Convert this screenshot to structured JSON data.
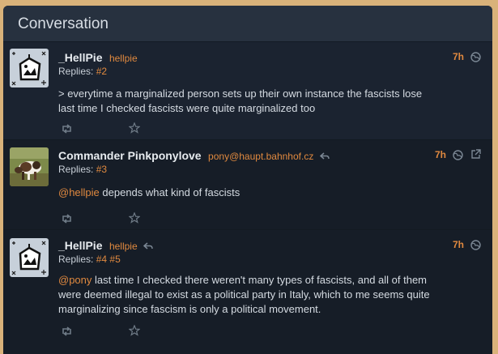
{
  "panel": {
    "title": "Conversation"
  },
  "statuses": [
    {
      "name": "_HellPie",
      "acct": "hellpie",
      "time": "7h",
      "replies_label": "Replies:",
      "replies": [
        "#2"
      ],
      "mention": "",
      "text_lines": [
        "> everytime a marginalized person sets up their own instance the fascists lose",
        "last time I checked fascists were quite marginalized too"
      ]
    },
    {
      "name": "Commander Pinkponylove",
      "acct": "pony@haupt.bahnhof.cz",
      "time": "7h",
      "replies_label": "Replies:",
      "replies": [
        "#3"
      ],
      "mention": "@hellpie",
      "text_lines": [
        " depends what kind of fascists"
      ]
    },
    {
      "name": "_HellPie",
      "acct": "hellpie",
      "time": "7h",
      "replies_label": "Replies:",
      "replies": [
        "#4",
        "#5"
      ],
      "mention": "@pony",
      "text_lines": [
        " last time I checked there weren't many types of fascists, and all of them",
        "were deemed illegal to exist as a political party in Italy, which to me seems quite",
        "marginalizing since fascism is only a political movement."
      ]
    }
  ],
  "icons": {
    "avatar1": "cake-robot-icon",
    "avatar2": "pony-photo-avatar",
    "visibility": "globe-icon",
    "external": "external-link-icon",
    "retweet": "repeat-icon",
    "favorite": "star-icon",
    "in_reply": "reply-arrow-icon"
  },
  "colors": {
    "background": "#d9b27a",
    "panel": "#1e2734",
    "accent": "#e0893f",
    "text": "#d5dbe2"
  }
}
